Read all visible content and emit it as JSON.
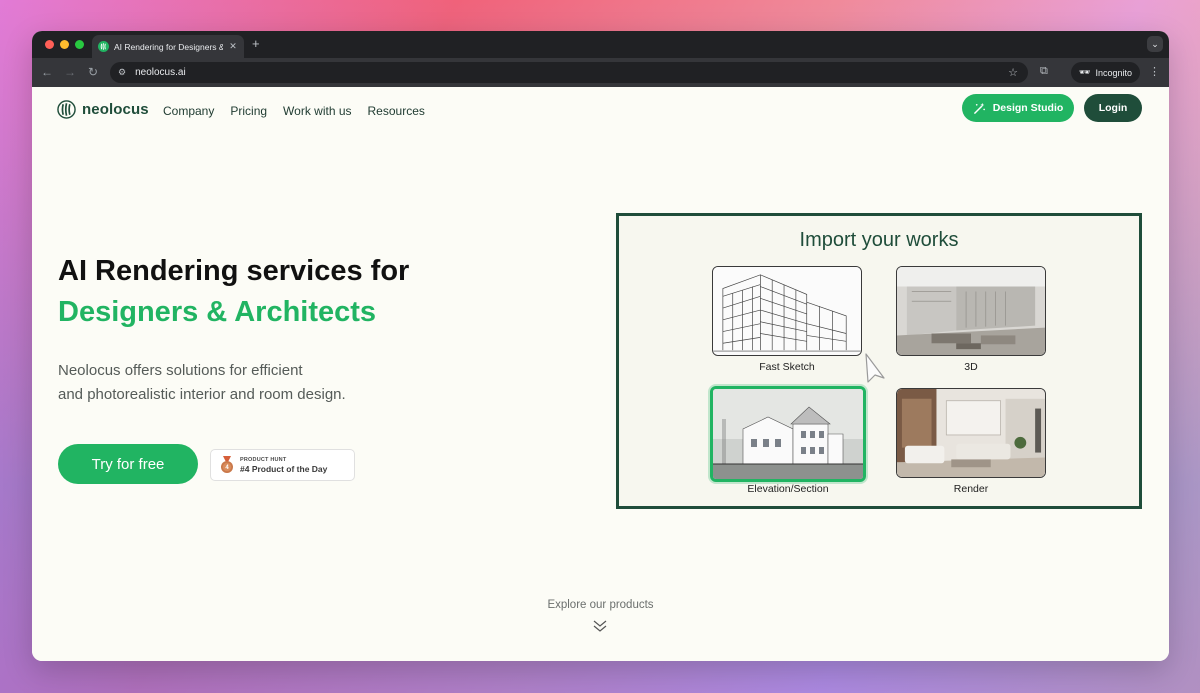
{
  "browser": {
    "tab_title": "AI Rendering for Designers &",
    "new_tab": "+",
    "tab_close": "✕",
    "url": "neolocus.ai",
    "incognito_label": "Incognito"
  },
  "nav": {
    "logo_text": "neolocus",
    "menu": [
      "Company",
      "Pricing",
      "Work with us",
      "Resources"
    ],
    "design_studio_label": "Design Studio",
    "login_label": "Login"
  },
  "hero": {
    "title_line1": "AI Rendering services for",
    "title_line2": "Designers & Architects",
    "desc_line1": "Neolocus offers solutions for efficient",
    "desc_line2": "and photorealistic interior and room design.",
    "cta_label": "Try for free",
    "badge_small": "PRODUCT HUNT",
    "badge_big": "#4 Product of the Day"
  },
  "import_panel": {
    "title": "Import your works",
    "tiles": [
      {
        "label": "Fast Sketch"
      },
      {
        "label": "3D"
      },
      {
        "label": "Elevation/Section",
        "selected": true
      },
      {
        "label": "Render"
      }
    ]
  },
  "footer": {
    "explore_label": "Explore our products"
  },
  "colors": {
    "brand_green": "#21b462",
    "brand_dark": "#1f4d3a",
    "page_bg": "#fcfcf6"
  }
}
